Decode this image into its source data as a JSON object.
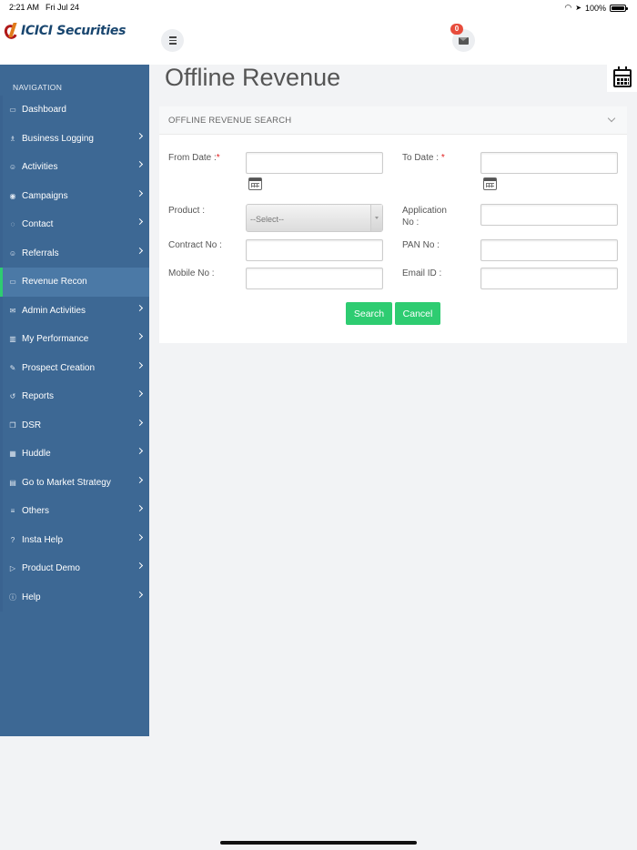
{
  "status_bar": {
    "time": "2:21 AM",
    "date": "Fri Jul 24",
    "battery": "100%"
  },
  "header": {
    "logo_text": "ICICI Securities",
    "mail_badge": "0"
  },
  "sidebar": {
    "title": "NAVIGATION",
    "items": [
      {
        "label": "Dashboard",
        "icon": "monitor-icon",
        "glyph": "▭",
        "has_children": false
      },
      {
        "label": "Business Logging",
        "icon": "flask-icon",
        "glyph": "♗",
        "has_children": true
      },
      {
        "label": "Activities",
        "icon": "users-icon",
        "glyph": "☺",
        "has_children": true
      },
      {
        "label": "Campaigns",
        "icon": "map-pin-icon",
        "glyph": "◉",
        "has_children": true
      },
      {
        "label": "Contact",
        "icon": "chat-icon",
        "glyph": "◌",
        "has_children": true
      },
      {
        "label": "Referrals",
        "icon": "user-group-icon",
        "glyph": "☺",
        "has_children": true
      },
      {
        "label": "Revenue Recon",
        "icon": "folder-icon",
        "glyph": "▭",
        "has_children": false
      },
      {
        "label": "Admin Activities",
        "icon": "envelope-icon",
        "glyph": "✉",
        "has_children": true
      },
      {
        "label": "My Performance",
        "icon": "bar-chart-icon",
        "glyph": "▥",
        "has_children": true
      },
      {
        "label": "Prospect Creation",
        "icon": "edit-icon",
        "glyph": "✎",
        "has_children": true
      },
      {
        "label": "Reports",
        "icon": "history-icon",
        "glyph": "↺",
        "has_children": true
      },
      {
        "label": "DSR",
        "icon": "copy-icon",
        "glyph": "❐",
        "has_children": true
      },
      {
        "label": "Huddle",
        "icon": "grid-icon",
        "glyph": "▦",
        "has_children": true
      },
      {
        "label": "Go to Market Strategy",
        "icon": "list-box-icon",
        "glyph": "▤",
        "has_children": true
      },
      {
        "label": "Others",
        "icon": "list-icon",
        "glyph": "≡",
        "has_children": true
      },
      {
        "label": "Insta Help",
        "icon": "question-icon",
        "glyph": "?",
        "has_children": true
      },
      {
        "label": "Product Demo",
        "icon": "play-icon",
        "glyph": "▷",
        "has_children": true
      },
      {
        "label": "Help",
        "icon": "info-icon",
        "glyph": "ⓘ",
        "has_children": true
      }
    ],
    "active_index": 6
  },
  "main": {
    "title": "Offline Revenue",
    "panel_title": "OFFLINE REVENUE SEARCH",
    "form": {
      "from_date_label": "From Date :",
      "to_date_label": "To Date :",
      "required_mark": "*",
      "product_label": "Product :",
      "product_selected": "--Select--",
      "application_label_1": "Application",
      "application_label_2": "No :",
      "contract_label": "Contract No :",
      "pan_label": "PAN No :",
      "mobile_label": "Mobile No :",
      "email_label": "Email ID :"
    },
    "buttons": {
      "search": "Search",
      "cancel": "Cancel"
    }
  },
  "colors": {
    "sidebar_bg": "#3d6894",
    "sidebar_active": "#4b79a6",
    "active_accent": "#2ecc71",
    "button_green": "#2ecc71",
    "badge_red": "#e74c3c",
    "logo_blue": "#19466f"
  }
}
